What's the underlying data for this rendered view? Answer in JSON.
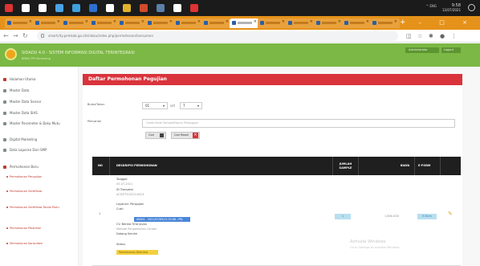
{
  "taskbar": {
    "icons": [
      {
        "name": "start-icon",
        "color": "#d33"
      },
      {
        "name": "search-icon",
        "color": "#fff"
      },
      {
        "name": "task-view-icon",
        "color": "#fff"
      },
      {
        "name": "store-icon",
        "color": "#4aa3e6"
      },
      {
        "name": "edge-icon",
        "color": "#3fa0e0"
      },
      {
        "name": "word-icon",
        "color": "#2b6fd0"
      },
      {
        "name": "photos-icon",
        "color": "#fff"
      },
      {
        "name": "chrome-icon",
        "color": "#e0b32b"
      },
      {
        "name": "ppt-icon",
        "color": "#d04a2b"
      },
      {
        "name": "explorer-icon",
        "color": "#5b7fa8"
      },
      {
        "name": "app-icon",
        "color": "#fff"
      },
      {
        "name": "record-icon",
        "color": "#d33"
      }
    ],
    "tray_icons": "^  ENG",
    "time": "9:58",
    "date": "12/07/2021"
  },
  "browser": {
    "tabs_count": 14,
    "active_tab_index": 8,
    "new_tab_label": "+",
    "window_controls": "– □ ×",
    "url": "smartcity.pemkab.go.id/sidaku/index.php/permohonan/konsumen"
  },
  "app": {
    "title": "SIDADU 4.0 - SISTEM INFORMASI DIGITAL TERINTEGRASI",
    "subtitle": "BBWS PPI Semarang",
    "user_label": "Administrator",
    "logout_label": "Logout",
    "accent_green": "#7cb845",
    "accent_red": "#d9333c"
  },
  "sidebar": {
    "items": [
      {
        "label": "Halaman Utama",
        "icon_color": "#c0392b"
      },
      {
        "label": "Master Data",
        "icon_color": "#7f8c8d"
      },
      {
        "label": "Master Data Sensor",
        "icon_color": "#7f8c8d"
      },
      {
        "label": "Master Data SIAS",
        "icon_color": "#7f8c8d"
      },
      {
        "label": "Master Parameter & Baku Mutu",
        "icon_color": "#7f8c8d"
      },
      {
        "label": "Digital Marketing",
        "icon_color": "#7f8c8d"
      },
      {
        "label": "Data Laporan Dari SMP",
        "icon_color": "#7f8c8d"
      },
      {
        "label": "Permohonan Baru",
        "icon_color": "#c0392b"
      }
    ],
    "subitems": [
      "Permohonan Pengujian",
      "Permohonan Sertifikasi",
      "Permohonan Sertifikasi Tanda Mutu",
      "Permohonan Pelatihan",
      "Permohonan Konsultasi"
    ]
  },
  "main": {
    "panel_title": "Daftar Permohonan Pegujian",
    "form": {
      "periode_label": "Bulan/Tahun",
      "month_value": "01",
      "sd_label": "s/d",
      "year_value": "7",
      "keyword_label": "Pencarian",
      "search_placeholder": "Cetak Kode Sampel/Nama Pelanggan",
      "cari_label": "Cari",
      "reset_label": "Cari Reset"
    },
    "table": {
      "headers": {
        "no": "NO",
        "deskripsi": "DESKRIPSI PERMOHONAN",
        "jumlah": "JUMLAH SAMPLE",
        "biaya": "BIAYA",
        "eform": "E-FORM"
      },
      "row": {
        "no": "1",
        "lines": [
          {
            "text": "Tanggal",
            "muted": false
          },
          {
            "text": "05-07-2021",
            "muted": true
          },
          {
            "text": "ID Transaksi",
            "muted": false
          },
          {
            "text": "ACS/PTS/2021/0001",
            "muted": true
          },
          {
            "text": "Layanan: Pengujian",
            "muted": false
          },
          {
            "text": "Cust:",
            "muted": false
          },
          {
            "text": "CV. Berkat Tirta Jayaa",
            "muted": false
          },
          {
            "text": "Metode Pengambilan Contoh",
            "muted": true
          },
          {
            "text": "Datang Sendiri",
            "muted": false
          },
          {
            "text": "Status",
            "muted": false
          }
        ],
        "status_highlight": "AK001 - 2021/07/05/11:19:08 - PRJ",
        "proses_badge": "Permohonan Diterima",
        "jumlah": "1",
        "biaya": "1.600.000",
        "eform_label": "E-Form",
        "edit_icon": "✎"
      }
    }
  },
  "watermark": {
    "line1": "Activate Windows",
    "line2": "Go to Settings to activate Windows."
  }
}
